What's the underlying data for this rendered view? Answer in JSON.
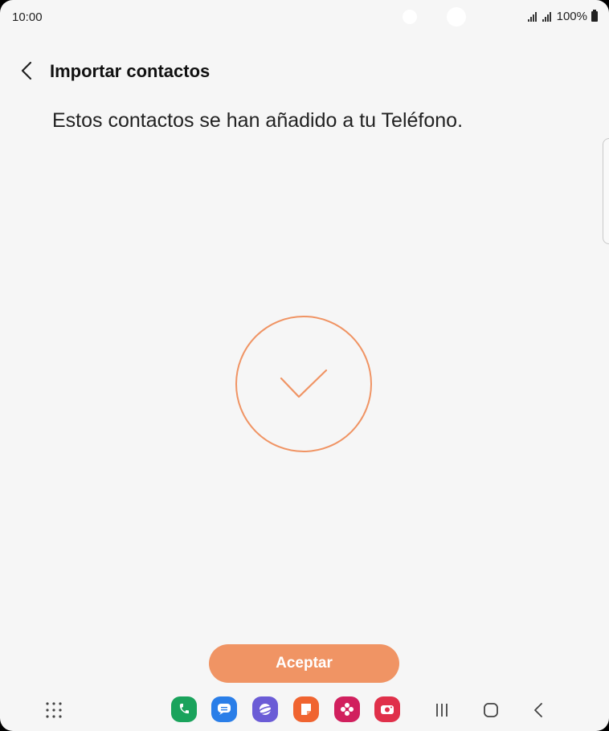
{
  "status_bar": {
    "time": "10:00",
    "battery": "100%"
  },
  "app_bar": {
    "title": "Importar contactos"
  },
  "content": {
    "message": "Estos contactos se han añadido a tu Teléfono."
  },
  "buttons": {
    "accept_label": "Aceptar"
  },
  "dock": {
    "apps": [
      {
        "name": "phone-app-icon",
        "color": "#1aa35c"
      },
      {
        "name": "messages-app-icon",
        "color": "#2a7ee8"
      },
      {
        "name": "internet-app-icon",
        "color": "#6b5cd6"
      },
      {
        "name": "notes-app-icon",
        "color": "#f06430"
      },
      {
        "name": "gallery-app-icon",
        "color": "#d1205e"
      },
      {
        "name": "camera-app-icon",
        "color": "#e0304a"
      }
    ]
  },
  "colors": {
    "accent": "#f09464",
    "background": "#f6f6f6"
  }
}
